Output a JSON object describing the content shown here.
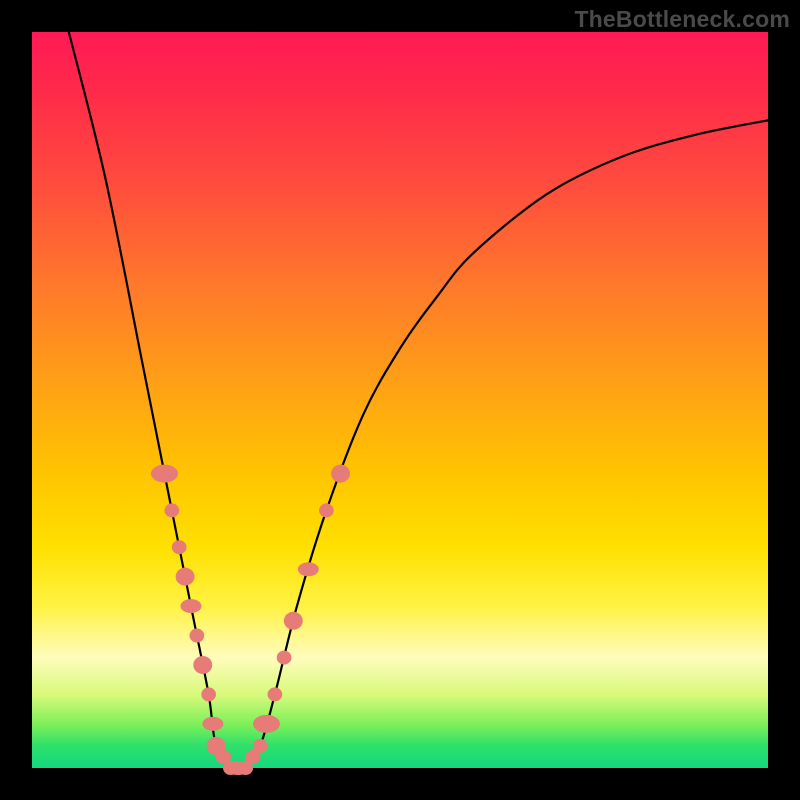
{
  "watermark": "TheBottleneck.com",
  "chart_data": {
    "type": "line",
    "title": "",
    "xlabel": "",
    "ylabel": "",
    "xlim": [
      0,
      100
    ],
    "ylim": [
      0,
      100
    ],
    "grid": false,
    "legend": false,
    "series": [
      {
        "name": "bottleneck-curve",
        "x": [
          5,
          10,
          15,
          18,
          20,
          22,
          24,
          25,
          27,
          29,
          31,
          33,
          36,
          40,
          45,
          50,
          55,
          60,
          70,
          80,
          90,
          100
        ],
        "y": [
          100,
          80,
          55,
          40,
          30,
          20,
          10,
          3,
          0,
          0,
          3,
          10,
          22,
          35,
          48,
          57,
          64,
          70,
          78,
          83,
          86,
          88
        ]
      }
    ],
    "annotations": {
      "beads_left": [
        40,
        35,
        30,
        26,
        22,
        18,
        14,
        10,
        6,
        3
      ],
      "beads_right": [
        3,
        6,
        10,
        15,
        20,
        27,
        35,
        40
      ]
    },
    "gradient_stops": [
      {
        "pct": 0,
        "color": "#ff1a55"
      },
      {
        "pct": 35,
        "color": "#ff7a2a"
      },
      {
        "pct": 60,
        "color": "#ffc400"
      },
      {
        "pct": 85,
        "color": "#fffcbd"
      },
      {
        "pct": 100,
        "color": "#15d87f"
      }
    ]
  }
}
